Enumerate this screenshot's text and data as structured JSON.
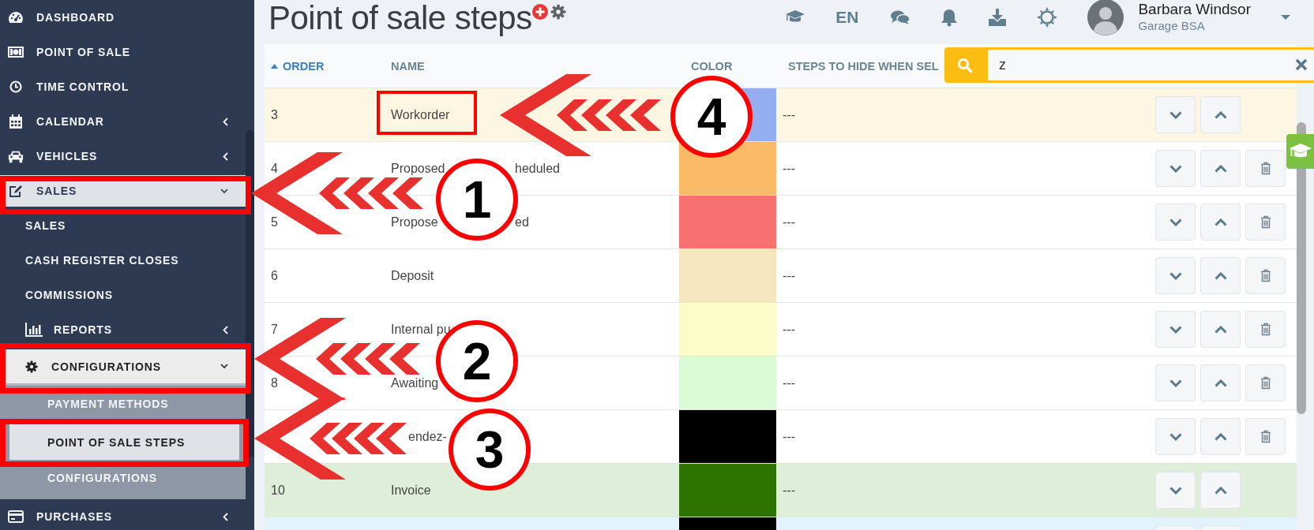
{
  "sidebar": {
    "items": [
      {
        "label": "DASHBOARD",
        "selected": false
      },
      {
        "label": "POINT OF SALE",
        "selected": false
      },
      {
        "label": "TIME CONTROL",
        "selected": false
      },
      {
        "label": "CALENDAR",
        "selected": false,
        "expanded": false
      },
      {
        "label": "VEHICLES",
        "selected": false,
        "expanded": false
      },
      {
        "label": "SALES",
        "selected": true,
        "expanded": true,
        "children": [
          {
            "label": "SALES",
            "selected": false
          },
          {
            "label": "CASH REGISTER CLOSES",
            "selected": false
          },
          {
            "label": "COMMISSIONS",
            "selected": false
          },
          {
            "label": "REPORTS",
            "selected": false,
            "expanded": false
          },
          {
            "label": "CONFIGURATIONS",
            "selected": true,
            "expanded": true,
            "children": [
              {
                "label": "PAYMENT METHODS",
                "selected": false
              },
              {
                "label": "POINT OF SALE STEPS",
                "selected": true
              },
              {
                "label": "CONFIGURATIONS",
                "selected": false
              }
            ]
          }
        ]
      },
      {
        "label": "PURCHASES",
        "selected": false,
        "expanded": false
      }
    ]
  },
  "header": {
    "title": "Point of sale steps",
    "language": "EN",
    "user": {
      "name": "Barbara Windsor",
      "company": "Garage BSA"
    }
  },
  "search": {
    "value": "z"
  },
  "table": {
    "columns": [
      {
        "label": "ORDER",
        "sorted": true
      },
      {
        "label": "NAME",
        "sorted": false
      },
      {
        "label": "COLOR",
        "sorted": false
      },
      {
        "label": "STEPS TO HIDE WHEN SEL",
        "sorted": false
      }
    ],
    "rows": [
      {
        "order": "3",
        "name": [
          "Workorder"
        ],
        "color": "#94aef0",
        "steps": "---",
        "deletable": false,
        "kind": "current"
      },
      {
        "order": "4",
        "name": [
          "Proposed",
          "heduled"
        ],
        "color": "#fbbb66",
        "steps": "---",
        "deletable": true
      },
      {
        "order": "5",
        "name": [
          "Propose",
          "ed"
        ],
        "color": "#f87171",
        "steps": "---",
        "deletable": true
      },
      {
        "order": "6",
        "name": [
          "Deposit"
        ],
        "color": "#f7e7c1",
        "steps": "---",
        "deletable": true
      },
      {
        "order": "7",
        "name": [
          "Internal pu"
        ],
        "color": "#fbfcc8",
        "steps": "---",
        "deletable": true
      },
      {
        "order": "8",
        "name": [
          "Awaiting"
        ],
        "color": "#dafbd6",
        "steps": "---",
        "deletable": true
      },
      {
        "name": [
          "endez-"
        ],
        "color": "#000000",
        "steps": "---",
        "deletable": true
      },
      {
        "order": "10",
        "name": [
          "Invoice"
        ],
        "color": "#2d7300",
        "steps": "---",
        "deletable": false,
        "kind": "final"
      },
      {
        "color": "#000000",
        "deletable": false,
        "kind": "info"
      }
    ]
  },
  "annotations": [
    {
      "label": "4"
    },
    {
      "label": "1"
    },
    {
      "label": "2"
    },
    {
      "label": "3"
    }
  ]
}
